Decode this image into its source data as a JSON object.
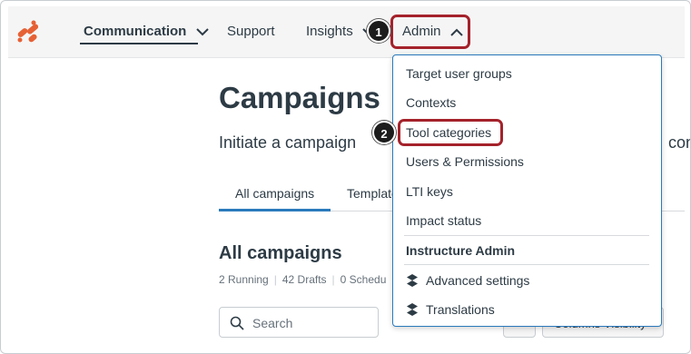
{
  "nav": {
    "items": [
      {
        "label": "Communication"
      },
      {
        "label": "Support"
      },
      {
        "label": "Insights"
      },
      {
        "label": "Admin"
      }
    ]
  },
  "annotations": {
    "badge_1": "1",
    "badge_2": "2"
  },
  "main": {
    "title": "Campaigns",
    "subtitle": "Initiate a campaign",
    "subtitle_tail": "cont",
    "tabs": [
      {
        "label": "All campaigns"
      },
      {
        "label": "Template"
      }
    ],
    "section_title": "All campaigns",
    "stats": {
      "running": "2 Running",
      "drafts": "42 Drafts",
      "scheduled": "0 Schedu"
    },
    "search": {
      "placeholder": "Search"
    },
    "columns_button": "Columns Visibility"
  },
  "admin_menu": {
    "items": [
      {
        "label": "Target user groups"
      },
      {
        "label": "Contexts"
      },
      {
        "label": "Tool categories"
      },
      {
        "label": "Users & Permissions"
      },
      {
        "label": "LTI keys"
      },
      {
        "label": "Impact status"
      }
    ],
    "section_heading": "Instructure Admin",
    "section_items": [
      {
        "label": "Advanced settings",
        "icon": "instructure-icon"
      },
      {
        "label": "Translations",
        "icon": "instructure-icon"
      }
    ]
  },
  "colors": {
    "accent": "#2b7abc",
    "highlight": "#a4222b",
    "brand": "#e66135"
  }
}
